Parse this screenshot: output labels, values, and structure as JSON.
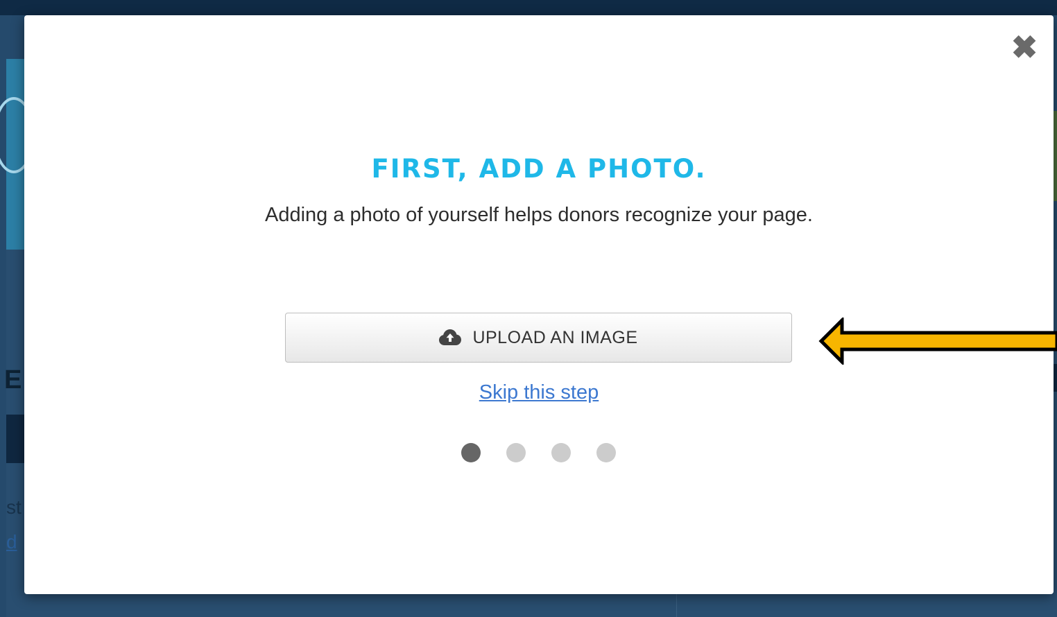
{
  "modal": {
    "close_icon": "close-x-icon",
    "title": "FIRST, ADD A PHOTO.",
    "subtitle": "Adding a photo of yourself helps donors recognize your page.",
    "upload_button": {
      "icon": "cloud-upload-icon",
      "label": "UPLOAD AN IMAGE"
    },
    "skip_link": "Skip this step",
    "steps": {
      "total": 4,
      "current": 1
    }
  },
  "background": {
    "heading_fragment": "ED",
    "text_fragment": "st",
    "link_fragment": "d"
  },
  "annotation": {
    "arrow_icon": "yellow-arrow-left-icon",
    "arrow_color": "#f7b500"
  },
  "colors": {
    "title": "#1fb8e8",
    "link": "#3c78d0",
    "dot_active": "#666666",
    "dot_inactive": "#cccccc",
    "overlay": "#1d4466"
  }
}
